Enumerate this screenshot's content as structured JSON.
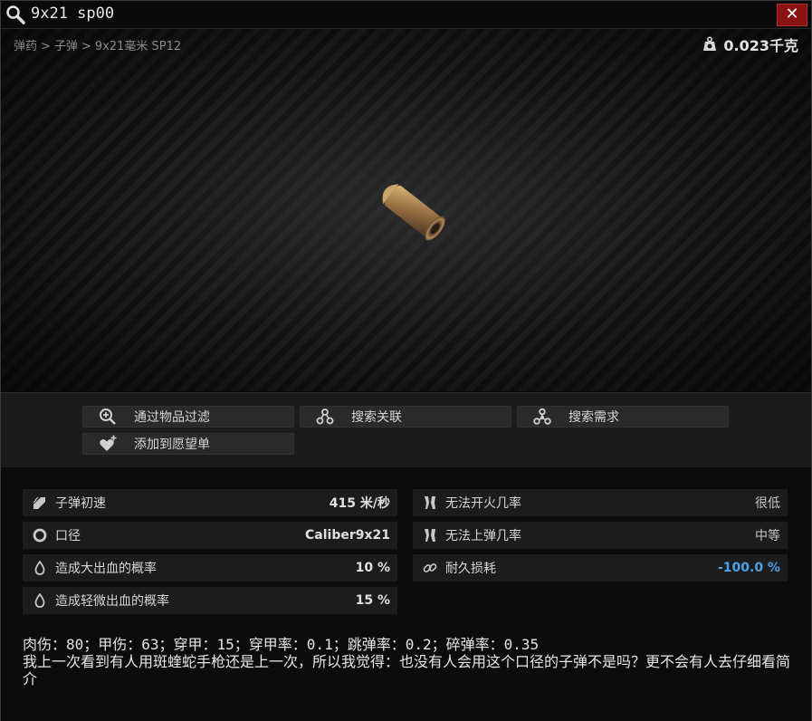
{
  "window": {
    "title": "9x21 sp00",
    "close_label": "✕"
  },
  "breadcrumb": [
    "弹药",
    ">",
    "子弹",
    ">",
    "9x21毫米 SP12"
  ],
  "weight": "0.023千克",
  "actions": {
    "filter_label": "通过物品过滤",
    "links_label": "搜索关联",
    "required_label": "搜索需求",
    "wishlist_label": "添加到愿望单"
  },
  "stats": {
    "left": [
      {
        "icon": "bullet-speed-icon",
        "label": "子弹初速",
        "value": "415 米/秒"
      },
      {
        "icon": "caliber-icon",
        "label": "口径",
        "value": "Caliber9x21"
      },
      {
        "icon": "heavy-bleed-icon",
        "label": "造成大出血的概率",
        "value": "10 %"
      },
      {
        "icon": "light-bleed-icon",
        "label": "造成轻微出血的概率",
        "value": "15 %"
      }
    ],
    "right": [
      {
        "icon": "misfire-icon",
        "label": "无法开火几率",
        "value": "很低"
      },
      {
        "icon": "failure-to-feed-icon",
        "label": "无法上弹几率",
        "value": "中等"
      },
      {
        "icon": "durability-burn-icon",
        "label": "耐久损耗",
        "value": "-100.0 %",
        "color": "#4aa3e8"
      }
    ]
  },
  "description": {
    "line1": "肉伤：80；甲伤：63；穿甲：15；穿甲率：0.1；跳弹率：0.2；碎弹率：0.35",
    "line2": "我上一次看到有人用斑蝰蛇手枪还是上一次，所以我觉得：也没有人会用这个口径的子弹不是吗？更不会有人去仔细看简介"
  }
}
